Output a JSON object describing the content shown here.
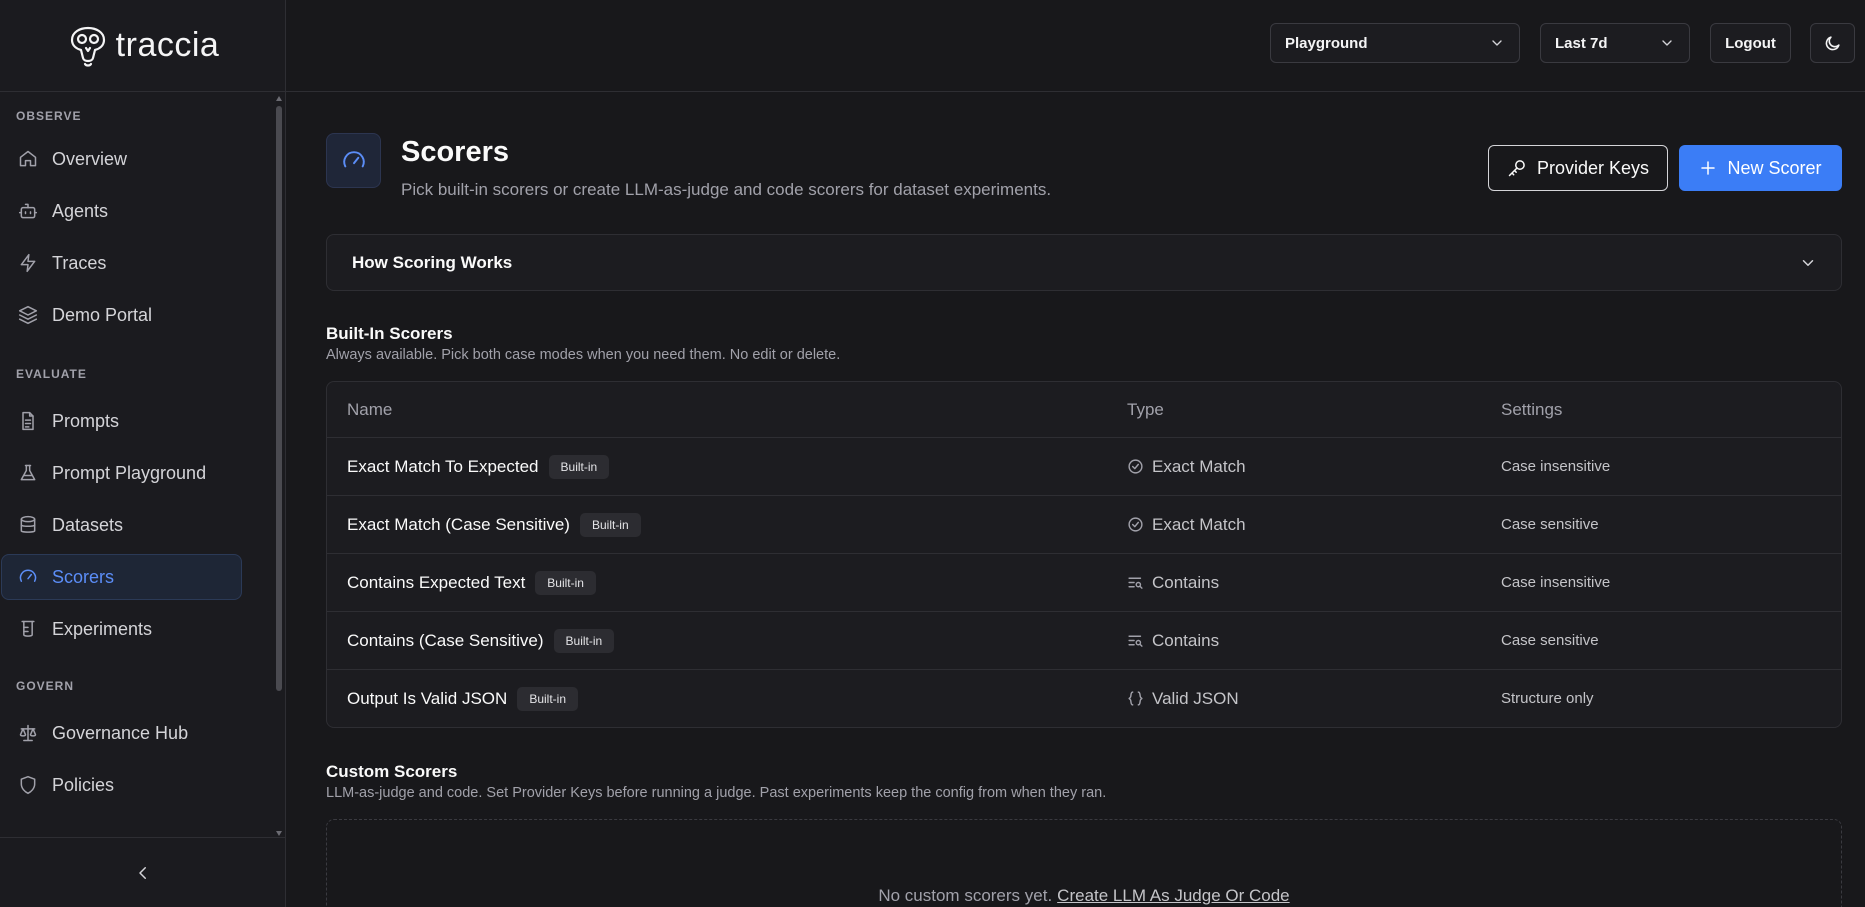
{
  "app": {
    "logo_text": "traccia"
  },
  "sidebar": {
    "sections": [
      {
        "label": "OBSERVE",
        "items": [
          {
            "label": "Overview",
            "icon": "home-icon"
          },
          {
            "label": "Agents",
            "icon": "bot-icon"
          },
          {
            "label": "Traces",
            "icon": "zap-icon"
          },
          {
            "label": "Demo Portal",
            "icon": "layers-icon"
          }
        ]
      },
      {
        "label": "EVALUATE",
        "items": [
          {
            "label": "Prompts",
            "icon": "file-text-icon"
          },
          {
            "label": "Prompt Playground",
            "icon": "flask-icon"
          },
          {
            "label": "Datasets",
            "icon": "database-icon"
          },
          {
            "label": "Scorers",
            "icon": "gauge-icon",
            "active": true
          },
          {
            "label": "Experiments",
            "icon": "beaker-icon"
          }
        ]
      },
      {
        "label": "GOVERN",
        "items": [
          {
            "label": "Governance Hub",
            "icon": "scale-icon"
          },
          {
            "label": "Policies",
            "icon": "shield-icon"
          }
        ]
      }
    ]
  },
  "topbar": {
    "project_select": "Playground",
    "range_select": "Last 7d",
    "logout_label": "Logout"
  },
  "page": {
    "title": "Scorers",
    "subtitle": "Pick built-in scorers or create LLM-as-judge and code scorers for dataset experiments.",
    "provider_keys_label": "Provider Keys",
    "new_scorer_label": "New Scorer",
    "accordion_label": "How Scoring Works"
  },
  "builtin": {
    "title": "Built-In Scorers",
    "subtitle": "Always available. Pick both case modes when you need them. No edit or delete.",
    "columns": [
      "Name",
      "Type",
      "Settings"
    ],
    "rows": [
      {
        "name": "Exact Match To Expected",
        "badge": "Built-in",
        "type": "Exact Match",
        "type_icon": "check-circle-icon",
        "settings": "Case insensitive"
      },
      {
        "name": "Exact Match (Case Sensitive)",
        "badge": "Built-in",
        "type": "Exact Match",
        "type_icon": "check-circle-icon",
        "settings": "Case sensitive"
      },
      {
        "name": "Contains Expected Text",
        "badge": "Built-in",
        "type": "Contains",
        "type_icon": "text-search-icon",
        "settings": "Case insensitive"
      },
      {
        "name": "Contains (Case Sensitive)",
        "badge": "Built-in",
        "type": "Contains",
        "type_icon": "text-search-icon",
        "settings": "Case sensitive"
      },
      {
        "name": "Output Is Valid JSON",
        "badge": "Built-in",
        "type": "Valid JSON",
        "type_icon": "braces-icon",
        "settings": "Structure only"
      }
    ]
  },
  "custom": {
    "title": "Custom Scorers",
    "subtitle": "LLM-as-judge and code. Set Provider Keys before running a judge. Past experiments keep the config from when they ran.",
    "empty_text": "No custom scorers yet.",
    "empty_link": "Create LLM As Judge Or Code"
  },
  "colors": {
    "accent": "#3b7df6",
    "background": "#18181b",
    "panel": "#1c1c20"
  }
}
